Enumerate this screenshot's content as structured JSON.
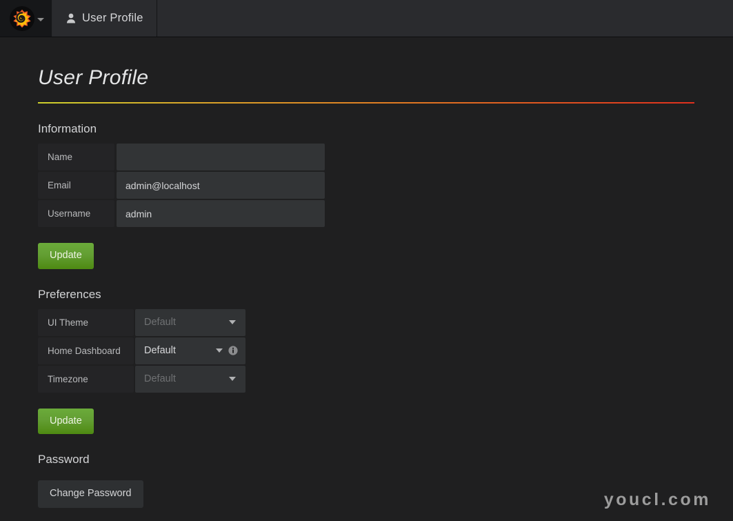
{
  "navbar": {
    "logo_icon": "grafana-logo-icon",
    "logo_caret_icon": "chevron-down-icon",
    "tab": {
      "icon": "user-icon",
      "label": "User Profile"
    }
  },
  "page": {
    "title": "User Profile"
  },
  "information": {
    "heading": "Information",
    "rows": [
      {
        "label": "Name",
        "value": "",
        "placeholder": "",
        "name": "name"
      },
      {
        "label": "Email",
        "value": "admin@localhost",
        "placeholder": "",
        "name": "email"
      },
      {
        "label": "Username",
        "value": "admin",
        "placeholder": "",
        "name": "username"
      }
    ],
    "update_label": "Update"
  },
  "preferences": {
    "heading": "Preferences",
    "rows": [
      {
        "label": "UI Theme",
        "value": "Default",
        "state": "placeholder",
        "info": false,
        "name": "ui-theme"
      },
      {
        "label": "Home Dashboard",
        "value": "Default",
        "state": "filled",
        "info": true,
        "info_icon": "info-icon",
        "name": "home-dashboard"
      },
      {
        "label": "Timezone",
        "value": "Default",
        "state": "placeholder",
        "info": false,
        "name": "timezone"
      }
    ],
    "update_label": "Update"
  },
  "password": {
    "heading": "Password",
    "change_label": "Change Password"
  },
  "watermark": {
    "text": "youcl.com"
  },
  "colors": {
    "page_bg": "#1f1f20",
    "navbar_bg": "#161719",
    "tab_bg": "#2a2b2e",
    "input_bg": "#323436",
    "label_bg": "#242426",
    "accent_green": "#639e33",
    "rule_start": "#cdd02c",
    "rule_end": "#e0301e"
  }
}
